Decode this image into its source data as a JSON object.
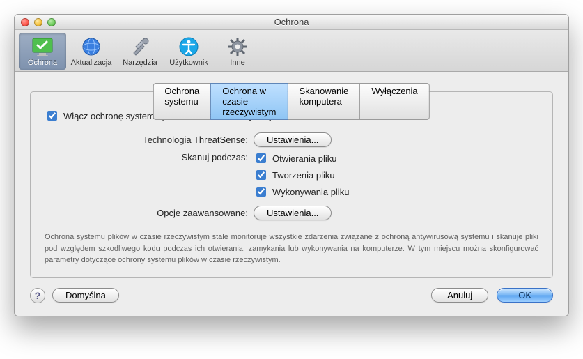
{
  "window": {
    "title": "Ochrona"
  },
  "toolbar": {
    "items": [
      {
        "label": "Ochrona"
      },
      {
        "label": "Aktualizacja"
      },
      {
        "label": "Narzędzia"
      },
      {
        "label": "Użytkownik"
      },
      {
        "label": "Inne"
      }
    ]
  },
  "tabs": {
    "items": [
      {
        "label": "Ochrona systemu"
      },
      {
        "label": "Ochrona w czasie rzeczywistym"
      },
      {
        "label": "Skanowanie komputera"
      },
      {
        "label": "Wyłączenia"
      }
    ]
  },
  "form": {
    "enable_label": "Włącz ochronę systemu plików w czasie rzeczywistym",
    "threatsense_label": "Technologia ThreatSense:",
    "threatsense_button": "Ustawienia...",
    "scan_label": "Skanuj podczas:",
    "scan_opts": {
      "open": "Otwierania pliku",
      "create": "Tworzenia pliku",
      "exec": "Wykonywania pliku"
    },
    "advanced_label": "Opcje zaawansowane:",
    "advanced_button": "Ustawienia..."
  },
  "description": "Ochrona systemu plików w czasie rzeczywistym stale monitoruje wszystkie zdarzenia związane z ochroną antywirusową systemu i skanuje pliki pod względem szkodliwego kodu podczas ich otwierania, zamykania lub wykonywania na komputerze. W tym miejscu można skonfigurować parametry dotyczące ochrony systemu plików w czasie rzeczywistym.",
  "footer": {
    "default": "Domyślna",
    "cancel": "Anuluj",
    "ok": "OK"
  }
}
